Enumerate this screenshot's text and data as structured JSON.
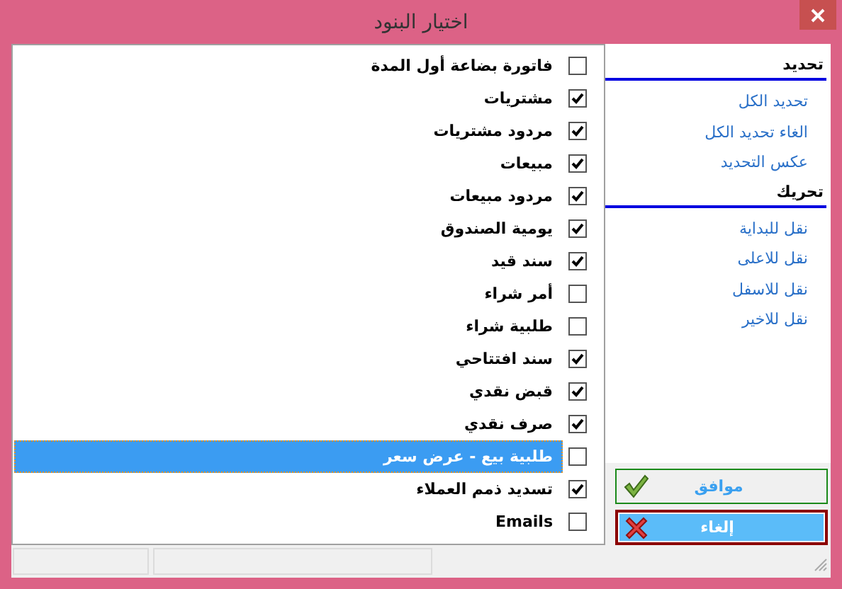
{
  "window": {
    "title": "اختيار البنود"
  },
  "items": [
    {
      "label": "فاتورة بضاعة أول المدة",
      "checked": false,
      "selected": false
    },
    {
      "label": "مشتريات",
      "checked": true,
      "selected": false
    },
    {
      "label": "مردود مشتريات",
      "checked": true,
      "selected": false
    },
    {
      "label": "مبيعات",
      "checked": true,
      "selected": false
    },
    {
      "label": "مردود مبيعات",
      "checked": true,
      "selected": false
    },
    {
      "label": "يومية الصندوق",
      "checked": true,
      "selected": false
    },
    {
      "label": "سند قيد",
      "checked": true,
      "selected": false
    },
    {
      "label": "أمر شراء",
      "checked": false,
      "selected": false
    },
    {
      "label": "طلبية شراء",
      "checked": false,
      "selected": false
    },
    {
      "label": "سند افتتاحي",
      "checked": true,
      "selected": false
    },
    {
      "label": "قبض نقدي",
      "checked": true,
      "selected": false
    },
    {
      "label": "صرف نقدي",
      "checked": true,
      "selected": false
    },
    {
      "label": "طلبية بيع - عرض سعر",
      "checked": false,
      "selected": true
    },
    {
      "label": "تسديد ذمم العملاء",
      "checked": true,
      "selected": false
    },
    {
      "label": "Emails",
      "checked": false,
      "selected": false
    }
  ],
  "sidebar": {
    "sections": [
      {
        "heading": "تحديد",
        "links": [
          "تحديد الكل",
          "الغاء تحديد الكل",
          "عكس التحديد"
        ]
      },
      {
        "heading": "تحريك",
        "links": [
          "نقل للبداية",
          "نقل للاعلى",
          "نقل للاسفل",
          "نقل للاخير"
        ]
      }
    ]
  },
  "buttons": [
    {
      "kind": "ok",
      "label": "موافق"
    },
    {
      "kind": "cancel",
      "label": "إلغاء"
    }
  ]
}
